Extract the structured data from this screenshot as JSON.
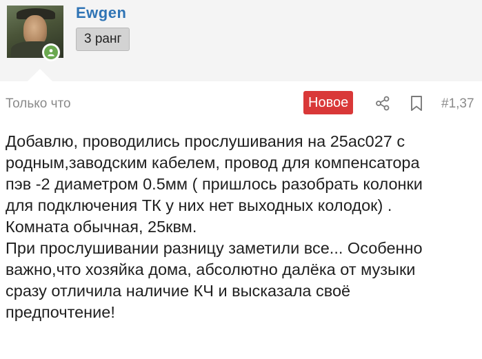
{
  "user": {
    "name": "Ewgen",
    "rank": "3 ранг",
    "online": true
  },
  "post": {
    "time": "Только что",
    "new_badge": "Новое",
    "number": "#1,37",
    "paragraphs": [
      "Добавлю, проводились прослушивания на 25ас027 с\nродным,заводским кабелем, провод для компенсатора\nпэв -2 диаметром 0.5мм ( пришлось разобрать колонки\nдля подключения ТК у них нет выходных колодок) .\nКомната обычная, 25квм.",
      "При прослушивании разницу заметили все... Особенно\nважно,что хозяйка дома, абсолютно далёка от музыки\nсразу отличила наличие КЧ и высказала своё\nпредпочтение!"
    ]
  },
  "icons": {
    "share": "share-icon",
    "bookmark": "bookmark-icon",
    "online_status": "user-online-icon"
  },
  "colors": {
    "username": "#2f74b5",
    "new_badge_bg": "#d93838",
    "online_green": "#6aa84f",
    "header_bg": "#f4f4f4",
    "meta_text": "#8a8a8a"
  }
}
